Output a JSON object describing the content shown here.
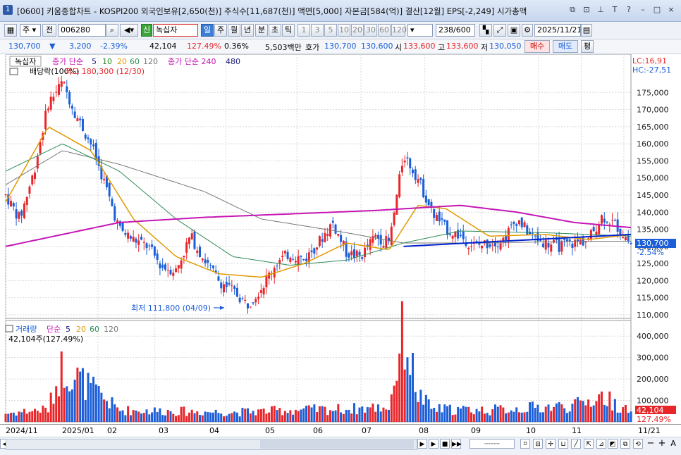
{
  "title_bar": {
    "window_number": "1",
    "text": "[0600] 키움종합차트 - KOSPI200 외국인보유[2,650(천)] 주식수[11,687(천)] 액면[5,000] 자본금[584(억)] 결산[12월] EPS[-2,249] 시가총액"
  },
  "toolbar": {
    "period_select": "주",
    "prev_label": "전",
    "stock_code": "006280",
    "credit_badge": "신",
    "stock_name": "녹십자",
    "period_tabs": [
      "일",
      "주",
      "월",
      "년",
      "분",
      "초",
      "틱"
    ],
    "selected_period": "일",
    "interval_buttons": [
      "1",
      "3",
      "5",
      "10",
      "20",
      "30",
      "60",
      "120"
    ],
    "count": "238",
    "count_total": "/600",
    "date": "2025/11/21"
  },
  "quote_bar": {
    "price": "130,700",
    "change": "3,200",
    "change_pct": "-2.39%",
    "volume": "42,104",
    "volume_ratio": "127.49%",
    "turnover": "0.36%",
    "amount": "5,503백만",
    "ask_label": "호가",
    "ask": "130,700",
    "bid": "130,600",
    "open_label": "시",
    "open": "133,600",
    "high_label": "고",
    "high": "133,600",
    "low_label": "저",
    "low": "130,050",
    "buy_button": "매수",
    "sell_button": "매도",
    "eval_button": "평"
  },
  "price_panel": {
    "legend_name": "녹십자",
    "legend_ma_short": "종가 단순",
    "ma_periods": [
      "5",
      "10",
      "20",
      "60",
      "120"
    ],
    "legend_ma_long": "종가 단순 240",
    "ma_long_extra": "480",
    "dividend_label": "배당락(100%)",
    "high_annotation": "최고 180,300 (12/30)",
    "low_annotation": "최저 111,800 (04/09)",
    "lc_label": "LC:16,91",
    "hc_label": "HC:-27,51",
    "current_price_tag": "130,700",
    "current_pct_tag": "-2.54%"
  },
  "volume_panel": {
    "legend_name": "거래량",
    "legend_ma": "단순",
    "ma_periods": [
      "5",
      "20",
      "60",
      "120"
    ],
    "current_volume_label": "42,104주(127.49%)",
    "current_volume_tag": "42,104",
    "current_pct_tag": "127.49%"
  },
  "x_axis": [
    "2024/11",
    "2025/01",
    "02",
    "03",
    "04",
    "05",
    "06",
    "07",
    "08",
    "09",
    "10",
    "11",
    "11/21"
  ],
  "colors": {
    "up": "#e8262a",
    "down": "#1b5ed8",
    "ma5": "#1c1c7a",
    "ma10": "#228b22",
    "ma20": "#e09a00",
    "ma60": "#2e8b57",
    "ma120": "#777777",
    "ma240": "#c516b4",
    "trendline": "#0022cc"
  },
  "chart_data": {
    "type": "candlestick",
    "title": "녹십자",
    "y_axis": {
      "min": 110000,
      "max": 180000,
      "step": 5000
    },
    "volume_axis": {
      "min": 0,
      "max": 400000,
      "step": 100000
    },
    "price_path": [
      [
        0,
        145000
      ],
      [
        1,
        138000
      ],
      [
        2,
        152000
      ],
      [
        3,
        172000
      ],
      [
        4,
        178000
      ],
      [
        5,
        168000
      ],
      [
        6,
        160000
      ],
      [
        7,
        148000
      ],
      [
        8,
        135000
      ],
      [
        9,
        132000
      ],
      [
        10,
        130000
      ],
      [
        11,
        124000
      ],
      [
        12,
        123000
      ],
      [
        13,
        133000
      ],
      [
        14,
        126000
      ],
      [
        15,
        120000
      ],
      [
        16,
        117000
      ],
      [
        17,
        113000
      ],
      [
        18,
        118000
      ],
      [
        19,
        125000
      ],
      [
        20,
        128000
      ],
      [
        21,
        126000
      ],
      [
        22,
        131000
      ],
      [
        23,
        137000
      ],
      [
        24,
        128000
      ],
      [
        25,
        127000
      ],
      [
        26,
        133000
      ],
      [
        27,
        131000
      ],
      [
        28,
        157000
      ],
      [
        29,
        150000
      ],
      [
        30,
        140000
      ],
      [
        31,
        135000
      ],
      [
        32,
        133000
      ],
      [
        33,
        130000
      ],
      [
        34,
        131000
      ],
      [
        35,
        132000
      ],
      [
        36,
        138000
      ],
      [
        37,
        133000
      ],
      [
        38,
        131000
      ],
      [
        39,
        130000
      ],
      [
        40,
        131000
      ],
      [
        41,
        132000
      ],
      [
        42,
        139000
      ],
      [
        43,
        136000
      ],
      [
        44,
        130700
      ]
    ],
    "ma240_path": [
      [
        0,
        130000
      ],
      [
        8,
        137000
      ],
      [
        14,
        138500
      ],
      [
        20,
        139500
      ],
      [
        26,
        140500
      ],
      [
        32,
        142000
      ],
      [
        36,
        140000
      ],
      [
        40,
        137000
      ],
      [
        44,
        135500
      ]
    ],
    "ma120_path": [
      [
        0,
        148000
      ],
      [
        4,
        158000
      ],
      [
        8,
        154000
      ],
      [
        14,
        146000
      ],
      [
        18,
        138000
      ],
      [
        24,
        134000
      ],
      [
        28,
        131000
      ],
      [
        34,
        131000
      ],
      [
        40,
        131500
      ],
      [
        44,
        131500
      ]
    ],
    "ma60_path": [
      [
        0,
        152000
      ],
      [
        4,
        160000
      ],
      [
        8,
        152000
      ],
      [
        12,
        138000
      ],
      [
        16,
        127000
      ],
      [
        20,
        124500
      ],
      [
        24,
        126000
      ],
      [
        28,
        131000
      ],
      [
        32,
        134500
      ],
      [
        38,
        134000
      ],
      [
        44,
        133000
      ]
    ],
    "ma20_path": [
      [
        0,
        143000
      ],
      [
        3,
        165000
      ],
      [
        6,
        158000
      ],
      [
        9,
        138000
      ],
      [
        12,
        127000
      ],
      [
        15,
        122000
      ],
      [
        18,
        121000
      ],
      [
        21,
        125000
      ],
      [
        24,
        131000
      ],
      [
        27,
        129000
      ],
      [
        29,
        142000
      ],
      [
        31,
        141000
      ],
      [
        34,
        133000
      ],
      [
        38,
        133500
      ],
      [
        41,
        132000
      ],
      [
        44,
        133500
      ]
    ],
    "trendline": [
      [
        28,
        130000
      ],
      [
        44,
        133500
      ]
    ],
    "volume_path": [
      [
        0,
        40000
      ],
      [
        3,
        60000
      ],
      [
        4,
        260000
      ],
      [
        8,
        55000
      ],
      [
        12,
        50000
      ],
      [
        16,
        45000
      ],
      [
        20,
        55000
      ],
      [
        24,
        60000
      ],
      [
        27,
        70000
      ],
      [
        28,
        430000
      ],
      [
        29,
        130000
      ],
      [
        30,
        60000
      ],
      [
        34,
        55000
      ],
      [
        38,
        70000
      ],
      [
        40,
        75000
      ],
      [
        42,
        120000
      ],
      [
        44,
        42104
      ]
    ],
    "x_categories": [
      "2024/11",
      "2025/01",
      "02",
      "03",
      "04",
      "05",
      "06",
      "07",
      "08",
      "09",
      "10",
      "11"
    ]
  }
}
